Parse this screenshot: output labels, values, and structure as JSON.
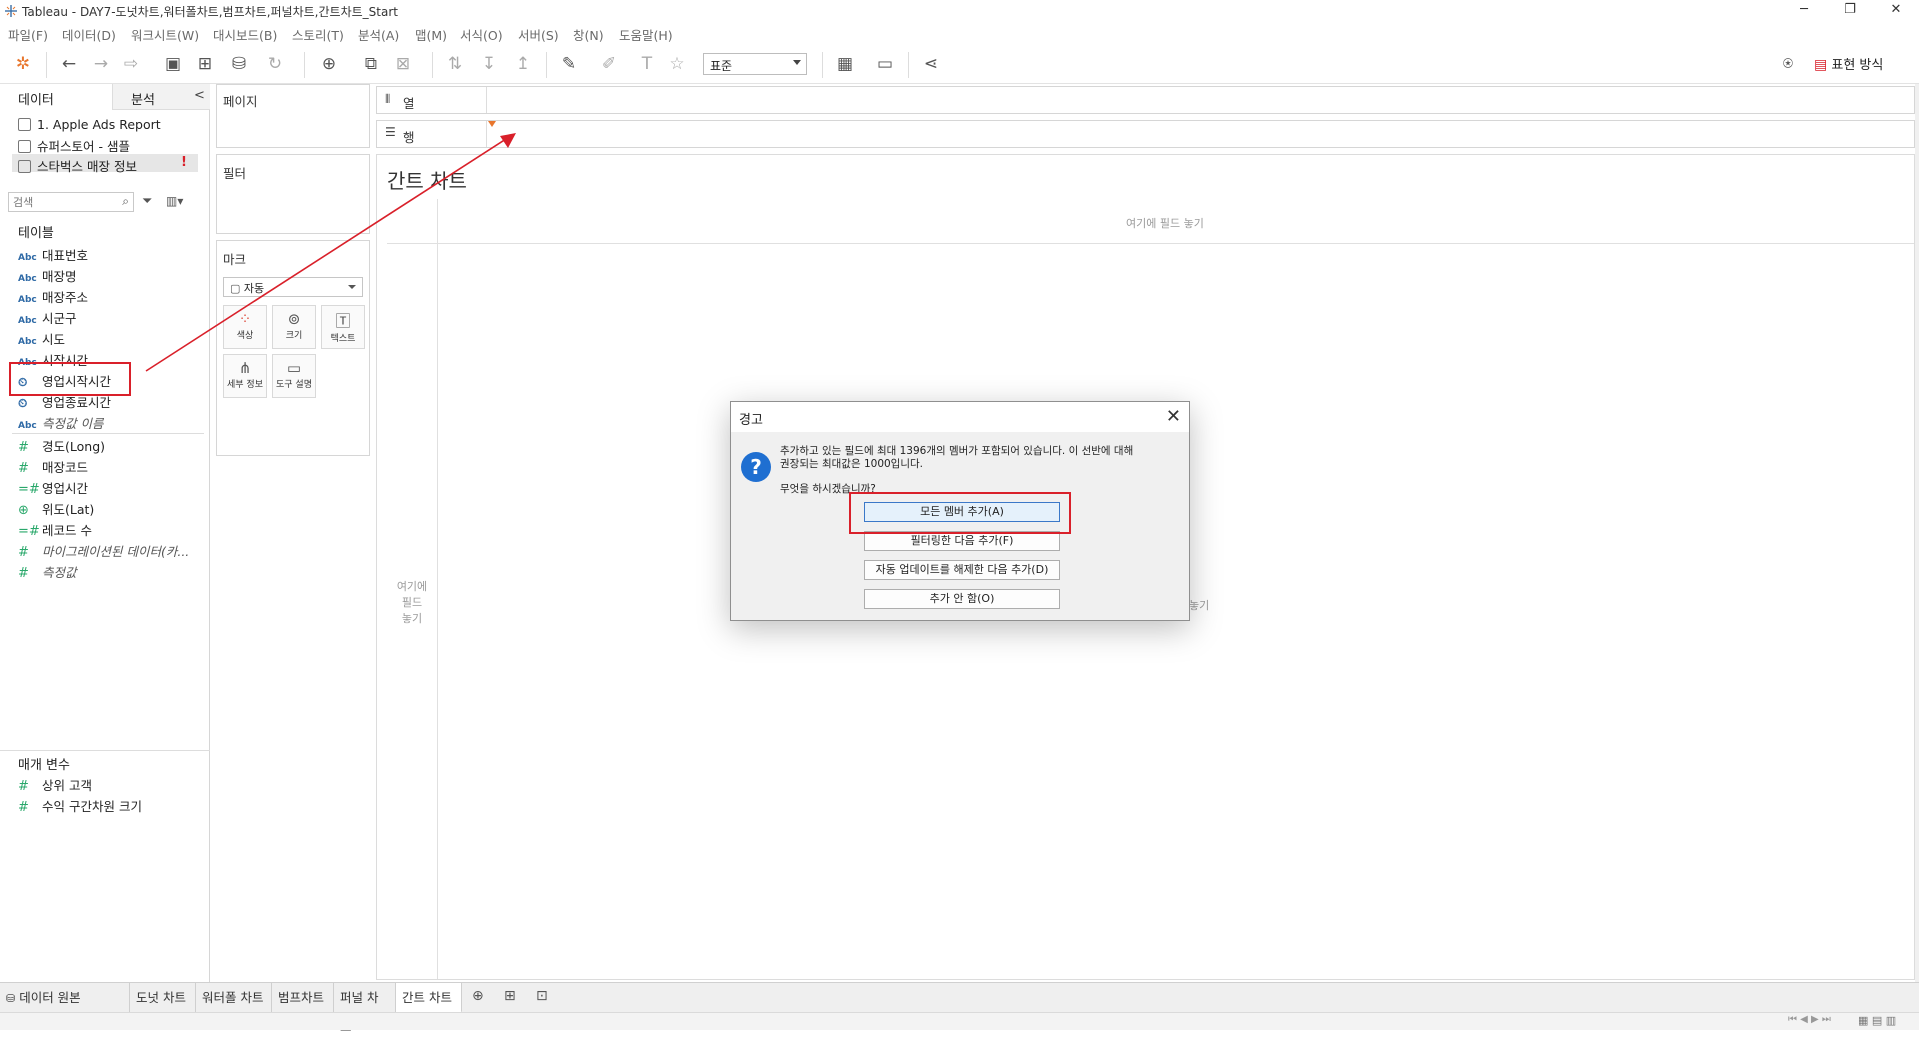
{
  "window": {
    "title": "Tableau - DAY7-도넛차트,워터폴차트,범프차트,퍼널차트,간트차트_Start",
    "controls": [
      "─",
      "❐",
      "✕"
    ]
  },
  "menu": [
    "파일(F)",
    "데이터(D)",
    "워크시트(W)",
    "대시보드(B)",
    "스토리(T)",
    "분석(A)",
    "맵(M)",
    "서식(O)",
    "서버(S)",
    "창(N)",
    "도움말(H)"
  ],
  "toolbar": {
    "fit_select": "표준",
    "show_me_label": "표현 방식"
  },
  "data_pane": {
    "tab_data": "데이터",
    "tab_analysis": "분석",
    "collapse": "<",
    "datasources": [
      "1. Apple Ads Report",
      "슈퍼스토어 - 샘플",
      "스타벅스 매장 정보"
    ],
    "warning_mark": "!",
    "search_placeholder": "검색",
    "tables_header": "테이블",
    "dimensions": [
      {
        "icon": "Abc",
        "label": "대표번호"
      },
      {
        "icon": "Abc",
        "label": "매장명"
      },
      {
        "icon": "Abc",
        "label": "매장주소"
      },
      {
        "icon": "Abc",
        "label": "시군구"
      },
      {
        "icon": "Abc",
        "label": "시도"
      },
      {
        "icon": "Abc",
        "label": "시작시간"
      },
      {
        "icon": "⏲",
        "label": "영업시작시간"
      },
      {
        "icon": "⏲",
        "label": "영업종료시간"
      },
      {
        "icon": "Abc",
        "label": "측정값 이름"
      }
    ],
    "measures": [
      {
        "icon": "#",
        "label": "경도(Long)"
      },
      {
        "icon": "#",
        "label": "매장코드"
      },
      {
        "icon": "=#",
        "label": "영업시간"
      },
      {
        "icon": "⊕",
        "label": "위도(Lat)"
      },
      {
        "icon": "=#",
        "label": "레코드 수"
      },
      {
        "icon": "#",
        "label": "마이그레이션된 데이터(카..."
      },
      {
        "icon": "#",
        "label": "측정값"
      }
    ],
    "params_header": "매개 변수",
    "params": [
      {
        "icon": "#",
        "label": "상위 고객"
      },
      {
        "icon": "#",
        "label": "수익 구간차원 크기"
      }
    ]
  },
  "shelves": {
    "pages": "페이지",
    "filters": "필터",
    "marks": "마크",
    "marks_type": "자동",
    "marks_buttons": [
      {
        "icon": "color-icon",
        "label": "색상"
      },
      {
        "icon": "size-icon",
        "label": "크기"
      },
      {
        "icon": "text-icon",
        "label": "텍스트"
      },
      {
        "icon": "detail-icon",
        "label": "세부 정보"
      },
      {
        "icon": "tooltip-icon",
        "label": "도구 설명"
      }
    ],
    "columns": "열",
    "rows": "행"
  },
  "view": {
    "title": "간트 차트",
    "drop_field_top": "여기에 필드 놓기",
    "drop_field_left": [
      "여기에",
      "필드",
      "놓기"
    ],
    "drop_field_center": "놓기"
  },
  "sheet_tabs": {
    "datasource": "데이터 원본",
    "tabs": [
      "도넛 차트",
      "워터폴 차트",
      "범프차트",
      "퍼널 차트",
      "간트 차트"
    ],
    "active": "간트 차트"
  },
  "dialog": {
    "title": "경고",
    "close": "✕",
    "icon": "?",
    "message_line1": "추가하고 있는 필드에 최대 1396개의 멤버가 포함되어 있습니다. 이 선반에 대해",
    "message_line2": "권장되는 최대값은 1000입니다.",
    "question": "무엇을 하시겠습니까?",
    "buttons": [
      "모든 멤버 추가(A)",
      "필터링한 다음 추가(F)",
      "자동 업데이트를 해제한 다음 추가(D)",
      "추가 안 함(O)"
    ]
  },
  "colors": {
    "annotation_red": "#d9202a",
    "dimension_blue": "#2f6aa6",
    "measure_green": "#2aa86b",
    "dialog_icon": "#1f6fd1"
  }
}
